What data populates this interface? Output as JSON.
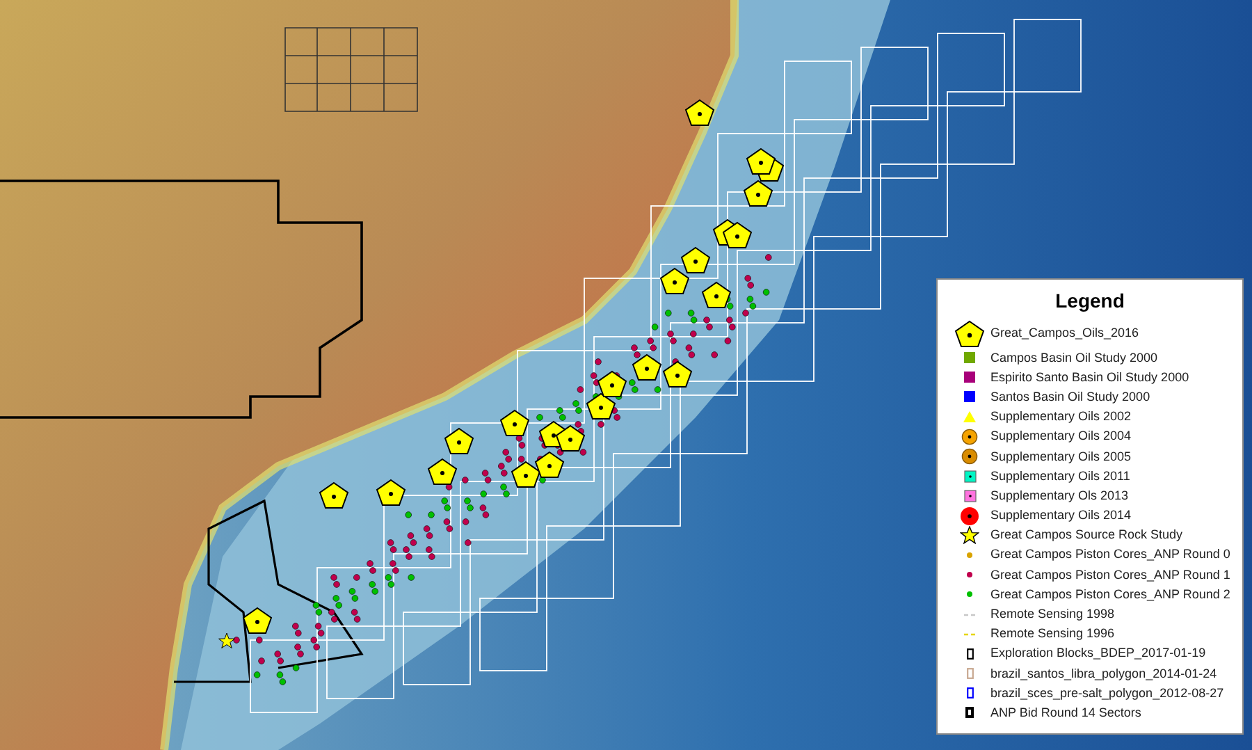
{
  "legend": {
    "title": "Legend",
    "items": [
      {
        "label": "Great_Campos_Oils_2016",
        "kind": "pentagon",
        "color": "#ffff00"
      },
      {
        "label": "Campos Basin Oil Study 2000",
        "kind": "square",
        "color": "#70a800"
      },
      {
        "label": "Espirito Santo Basin Oil Study 2000",
        "kind": "square",
        "color": "#a8007a"
      },
      {
        "label": "Santos Basin Oil Study 2000",
        "kind": "square",
        "color": "#0000ff"
      },
      {
        "label": "Supplementary Oils 2002",
        "kind": "triangle",
        "color": "#ffff00"
      },
      {
        "label": "Supplementary Oils 2004",
        "kind": "circle",
        "color": "#f5a300"
      },
      {
        "label": "Supplementary Oils 2005",
        "kind": "circle",
        "color": "#d98c00"
      },
      {
        "label": "Supplementary Oils 2011",
        "kind": "dotsquare",
        "color": "#00f5c4"
      },
      {
        "label": "Supplementary Ols 2013",
        "kind": "dotsquare",
        "color": "#ff73df"
      },
      {
        "label": "Supplementary Oils 2014",
        "kind": "bigcircle",
        "color": "#ff0000"
      },
      {
        "label": "Great Campos Source Rock Study",
        "kind": "star",
        "color": "#ffff00"
      },
      {
        "label": "Great Campos Piston Cores_ANP Round 0",
        "kind": "dot",
        "color": "#d9a300"
      },
      {
        "label": "Great Campos Piston Cores_ANP Round 1",
        "kind": "dot",
        "color": "#c0004c"
      },
      {
        "label": "Great Campos Piston Cores_ANP Round 2",
        "kind": "dot",
        "color": "#00c000"
      },
      {
        "label": "Remote Sensing 1998",
        "kind": "dash",
        "color": "#c8c8c8"
      },
      {
        "label": "Remote Sensing 1996",
        "kind": "dash",
        "color": "#e6d600"
      },
      {
        "label": "Exploration Blocks_BDEP_2017-01-19",
        "kind": "outline",
        "color": "#000000"
      },
      {
        "label": "brazil_santos_libra_polygon_2014-01-24",
        "kind": "outline",
        "color": "#c8a890"
      },
      {
        "label": "brazil_sces_pre-salt_polygon_2012-08-27",
        "kind": "outline",
        "color": "#0000ff"
      },
      {
        "label": "ANP Bid Round 14 Sectors",
        "kind": "thick",
        "color": "#000000"
      }
    ]
  }
}
